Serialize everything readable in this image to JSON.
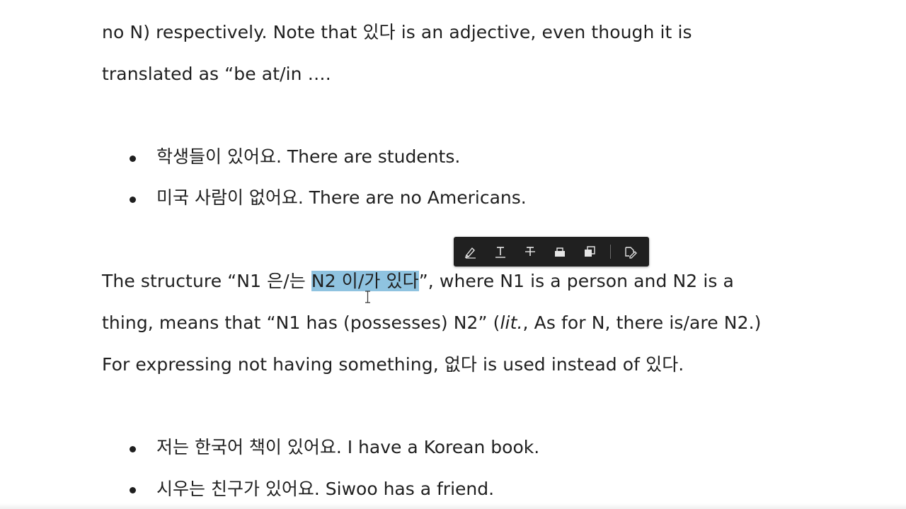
{
  "document": {
    "para1": {
      "line1": "no N) respectively. Note that 있다 is an adjective, even though it is",
      "line2": "translated as “be at/in …."
    },
    "bullets1": [
      "학생들이 있어요. There are students.",
      "미국 사람이 없어요. There are no Americans."
    ],
    "para2": {
      "line1_before": "The structure “N1 은/는 ",
      "line1_highlight": "N2 이/가 있다",
      "line1_after": "”, where N1 is a person and N2 is a",
      "line2_before": "thing, means that “N1 has (possesses) N2” (",
      "line2_italic": "lit.",
      "line2_after": ", As for N, there is/are N2.)",
      "line3": "For expressing not having something, 없다 is used instead of 있다."
    },
    "bullets2": [
      "저는 한국어 책이 있어요. I have a Korean book.",
      "시우는 친구가 있어요. Siwoo has a friend."
    ]
  },
  "toolbar": {
    "buttons": [
      {
        "name": "highlight-button",
        "icon": "highlighter-icon"
      },
      {
        "name": "underline-button",
        "icon": "underline-text-icon"
      },
      {
        "name": "strikethrough-button",
        "icon": "strikethrough-text-icon"
      },
      {
        "name": "redact-button",
        "icon": "eraser-icon"
      },
      {
        "name": "copy-button",
        "icon": "copy-icon"
      },
      {
        "name": "ai-edit-button",
        "icon": "sparkle-edit-icon"
      }
    ]
  },
  "colors": {
    "text": "#1f1f1f",
    "selection": "#8fc3e0",
    "toolbar_bg": "#202020",
    "toolbar_icon": "#e6e6e6"
  }
}
